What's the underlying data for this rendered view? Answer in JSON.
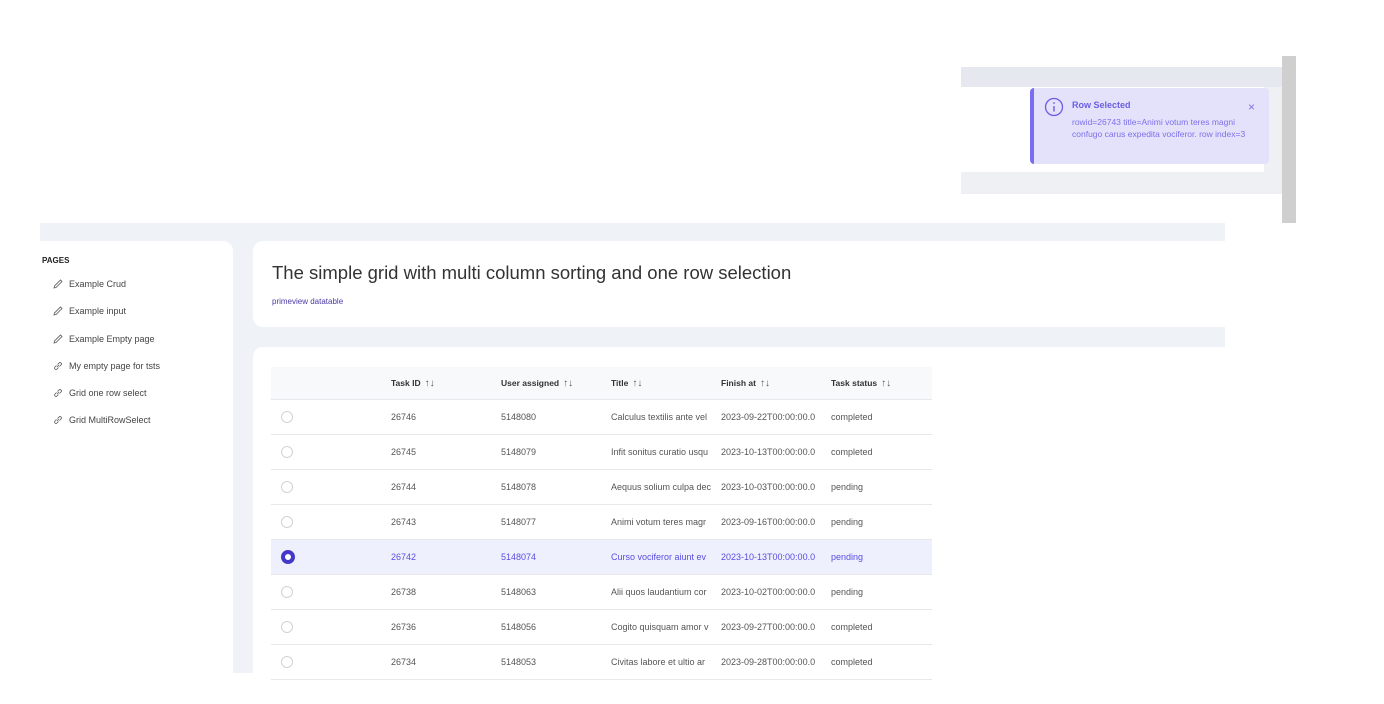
{
  "toast": {
    "title": "Row Selected",
    "detail": "rowid=26743 title=Animi votum teres magni confugo carus expedita vociferor. row index=3",
    "close": "×"
  },
  "sidebar": {
    "section_label": "PAGES",
    "items": [
      {
        "label": "Example Crud",
        "icon": "pencil-icon"
      },
      {
        "label": "Example input",
        "icon": "pencil-icon"
      },
      {
        "label": "Example Empty page",
        "icon": "pencil-icon"
      },
      {
        "label": "My empty page for tsts",
        "icon": "link-icon"
      },
      {
        "label": "Grid one row select",
        "icon": "link-icon"
      },
      {
        "label": "Grid MultiRowSelect",
        "icon": "link-icon"
      }
    ]
  },
  "header": {
    "title": "The simple grid with multi column sorting and one row selection",
    "subtitle": "primeview datatable"
  },
  "table": {
    "columns": [
      "Task ID",
      "User assigned",
      "Title",
      "Finish at",
      "Task status"
    ],
    "sort_icon": "↑↓",
    "rows": [
      {
        "task_id": "26746",
        "user": "5148080",
        "title": "Calculus textilis ante vel",
        "finish": "2023-09-22T00:00:00.0",
        "status": "completed",
        "selected": false
      },
      {
        "task_id": "26745",
        "user": "5148079",
        "title": "Infit sonitus curatio usqu",
        "finish": "2023-10-13T00:00:00.0",
        "status": "completed",
        "selected": false
      },
      {
        "task_id": "26744",
        "user": "5148078",
        "title": "Aequus solium culpa dec",
        "finish": "2023-10-03T00:00:00.0",
        "status": "pending",
        "selected": false
      },
      {
        "task_id": "26743",
        "user": "5148077",
        "title": "Animi votum teres magr",
        "finish": "2023-09-16T00:00:00.0",
        "status": "pending",
        "selected": false
      },
      {
        "task_id": "26742",
        "user": "5148074",
        "title": "Curso vociferor aiunt ev",
        "finish": "2023-10-13T00:00:00.0",
        "status": "pending",
        "selected": true
      },
      {
        "task_id": "26738",
        "user": "5148063",
        "title": "Alii quos laudantium cor",
        "finish": "2023-10-02T00:00:00.0",
        "status": "pending",
        "selected": false
      },
      {
        "task_id": "26736",
        "user": "5148056",
        "title": "Cogito quisquam amor v",
        "finish": "2023-09-27T00:00:00.0",
        "status": "completed",
        "selected": false
      },
      {
        "task_id": "26734",
        "user": "5148053",
        "title": "Civitas labore et ultio ar",
        "finish": "2023-09-28T00:00:00.0",
        "status": "completed",
        "selected": false
      }
    ]
  },
  "colors": {
    "accent": "#4338ca",
    "toast_bg": "#e4e2fb",
    "selected_row_bg": "#eef0fd"
  }
}
